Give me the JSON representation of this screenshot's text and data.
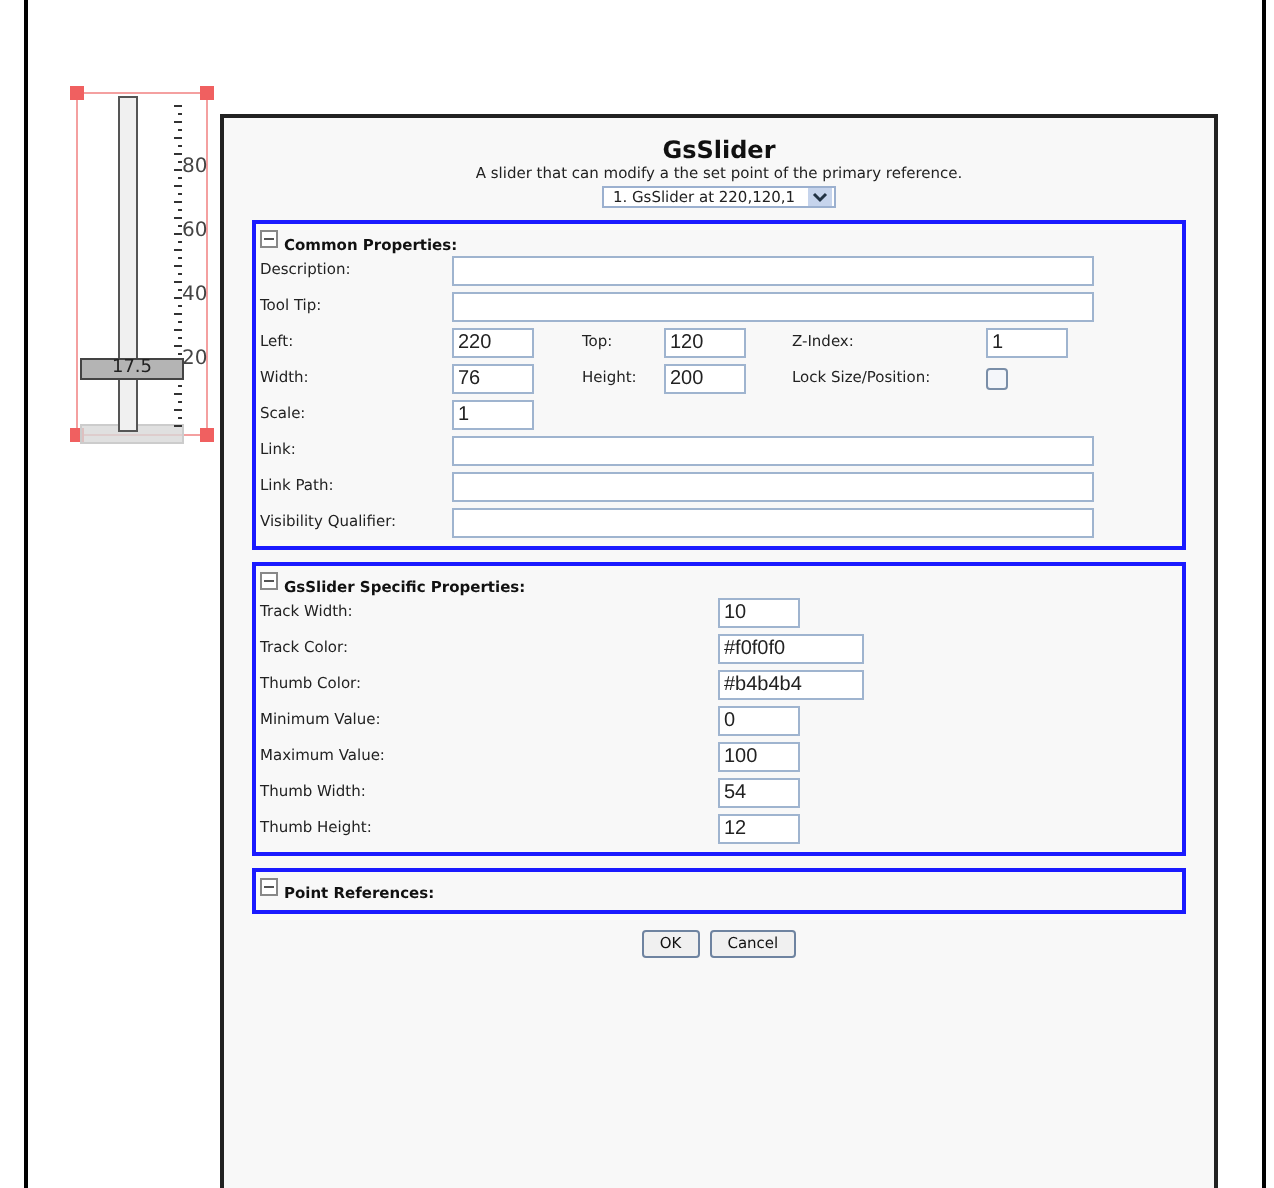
{
  "slider_widget": {
    "scale_labels": [
      "80",
      "60",
      "40",
      "20"
    ],
    "thumb_label": "17.5",
    "level": 0.175
  },
  "dialog": {
    "title": "GsSlider",
    "subtitle": "A slider that can modify a the set point of the primary reference.",
    "instance": "1. GsSlider at 220,120,1",
    "sections": [
      {
        "title": "Common Properties:",
        "expanded": true,
        "rows": [
          [
            {
              "label": "Description:",
              "kind": "wide"
            }
          ],
          [
            {
              "label": "Tool Tip:",
              "kind": "wide"
            }
          ],
          [
            {
              "label": "Left:",
              "kind": "short",
              "value": "220"
            },
            {
              "label": "Top:",
              "kind": "short",
              "value": "120"
            },
            {
              "label": "Z-Index:",
              "kind": "short",
              "value": "1"
            }
          ],
          [
            {
              "label": "Width:",
              "kind": "short",
              "value": "76"
            },
            {
              "label": "Height:",
              "kind": "short",
              "value": "200"
            },
            {
              "label": "Lock Size/Position:",
              "kind": "checkbox",
              "checked": false
            }
          ],
          [
            {
              "label": "Scale:",
              "kind": "short",
              "value": "1"
            }
          ],
          [
            {
              "label": "Link:",
              "kind": "wide"
            }
          ],
          [
            {
              "label": "Link Path:",
              "kind": "wide"
            }
          ],
          [
            {
              "label": "Visibility Qualifier:",
              "kind": "wide"
            }
          ]
        ]
      },
      {
        "title": "GsSlider Specific Properties:",
        "expanded": true,
        "rows": [
          [
            {
              "label": "Track Width:",
              "kind": "short",
              "value": "10"
            }
          ],
          [
            {
              "label": "Track Color:",
              "kind": "medium",
              "value": "#f0f0f0"
            }
          ],
          [
            {
              "label": "Thumb Color:",
              "kind": "medium",
              "value": "#b4b4b4"
            }
          ],
          [
            {
              "label": "Minimum Value:",
              "kind": "short",
              "value": "0"
            }
          ],
          [
            {
              "label": "Maximum Value:",
              "kind": "short",
              "value": "100"
            }
          ],
          [
            {
              "label": "Thumb Width:",
              "kind": "short",
              "value": "54"
            }
          ],
          [
            {
              "label": "Thumb Height:",
              "kind": "short",
              "value": "12"
            }
          ]
        ]
      },
      {
        "title": "Point References:",
        "expanded": true
      }
    ],
    "buttons": [
      "OK",
      "Cancel"
    ]
  }
}
